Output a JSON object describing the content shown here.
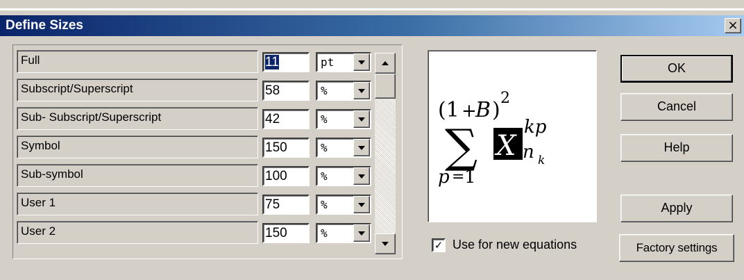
{
  "window": {
    "title": "Define Sizes",
    "close_label": "×"
  },
  "rows": [
    {
      "label": "Full",
      "value": "11",
      "unit": "pt",
      "selected": true
    },
    {
      "label": "Subscript/Superscript",
      "value": "58",
      "unit": "%",
      "selected": false
    },
    {
      "label": "Sub- Subscript/Superscript",
      "value": "42",
      "unit": "%",
      "selected": false
    },
    {
      "label": "Symbol",
      "value": "150",
      "unit": "%",
      "selected": false
    },
    {
      "label": "Sub-symbol",
      "value": "100",
      "unit": "%",
      "selected": false
    },
    {
      "label": "User 1",
      "value": "75",
      "unit": "%",
      "selected": false
    },
    {
      "label": "User 2",
      "value": "150",
      "unit": "%",
      "selected": false
    }
  ],
  "preview": {
    "paren_open": "(1",
    "plus": "+",
    "B": "B",
    "paren_close": ")",
    "exp": "2",
    "sigma": "∑",
    "X": "X",
    "sup": "kp",
    "n": "n",
    "k": "k",
    "lower": "p",
    "eq": "=",
    "one": "1"
  },
  "checkbox": {
    "label": "Use for new equations",
    "checked": true,
    "mark": "✓"
  },
  "buttons": {
    "ok": "OK",
    "cancel": "Cancel",
    "help": "Help",
    "apply": "Apply",
    "factory": "Factory settings"
  },
  "colors": {
    "title_start": "#0a246a",
    "title_end": "#a6caf0",
    "face": "#d4d0c8"
  }
}
